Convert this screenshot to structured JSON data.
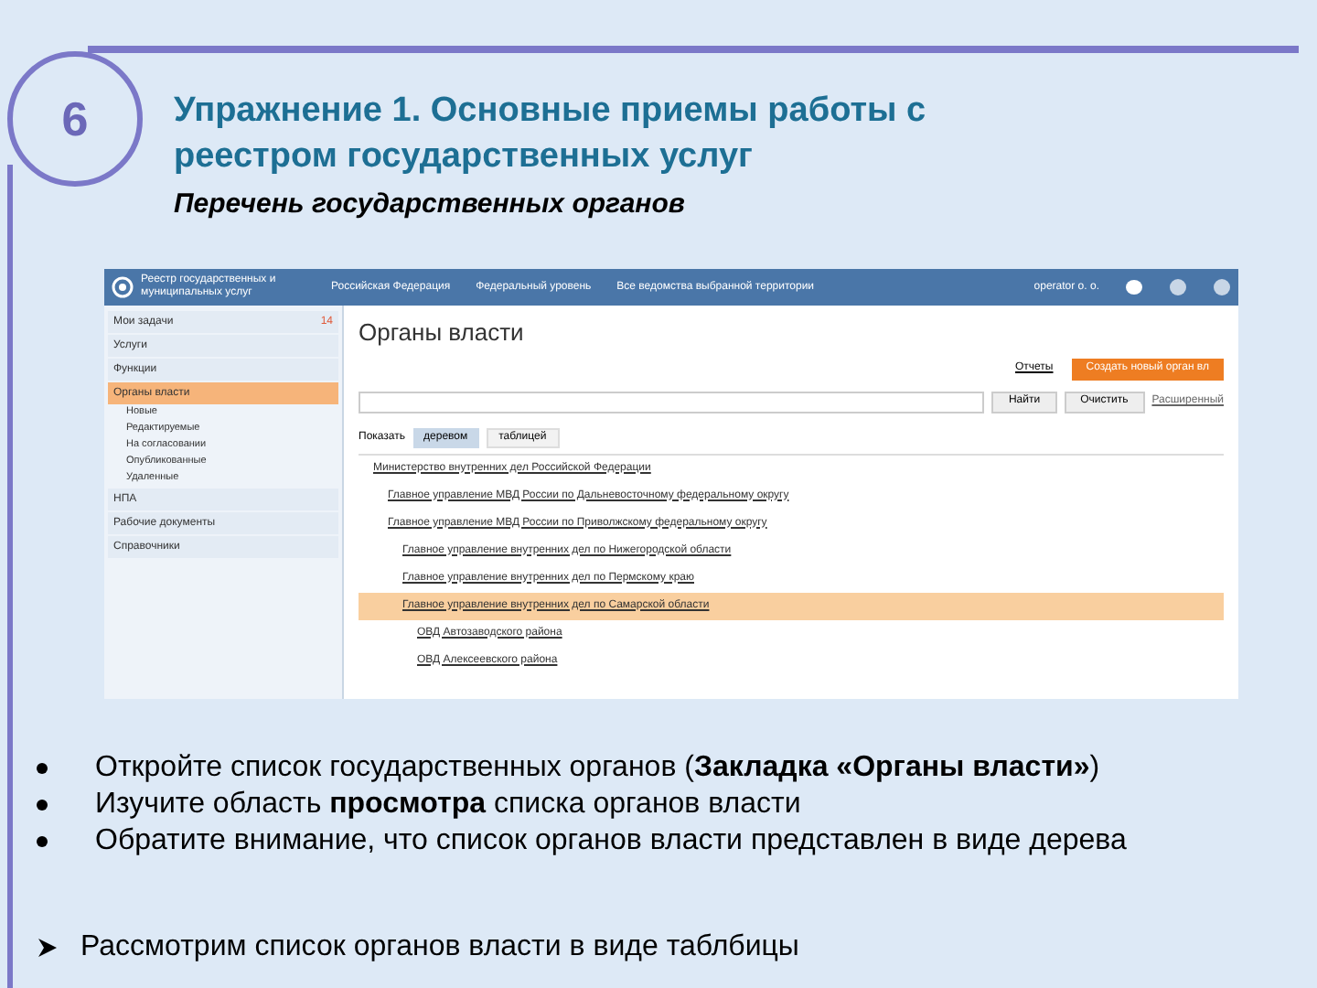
{
  "slide_number": "6",
  "title": "Упражнение 1. Основные приемы работы с реестром государственных услуг",
  "subtitle": "Перечень государственных органов",
  "app": {
    "logo_text": "Реестр государственных и муниципальных услуг",
    "nav": [
      "Российская Федерация",
      "Федеральный уровень",
      "Все ведомства выбранной территории"
    ],
    "user": "operator o. o.",
    "sidebar": [
      {
        "label": "Мои задачи",
        "badge": "14",
        "selected": false
      },
      {
        "label": "Услуги",
        "selected": false
      },
      {
        "label": "Функции",
        "selected": false
      },
      {
        "label": "Органы власти",
        "selected": true,
        "children": [
          "Новые",
          "Редактируемые",
          "На согласовании",
          "Опубликованные",
          "Удаленные"
        ]
      },
      {
        "label": "НПА",
        "selected": false
      },
      {
        "label": "Рабочие документы",
        "selected": false
      },
      {
        "label": "Справочники",
        "selected": false
      }
    ],
    "page_title": "Органы власти",
    "reports_link": "Отчеты",
    "create_button": "Создать новый орган вл",
    "find_button": "Найти",
    "clear_button": "Очистить",
    "advanced_link": "Расширенный",
    "show_label": "Показать",
    "view_tabs": [
      {
        "label": "деревом",
        "selected": true
      },
      {
        "label": "таблицей",
        "selected": false
      }
    ],
    "tree": [
      {
        "label": "Министерство внутренних дел Российской Федерации",
        "selected": false,
        "children": [
          {
            "label": "Главное управление МВД России по Дальневосточному федеральному округу",
            "selected": false
          },
          {
            "label": "Главное управление МВД России по Приволжскому федеральному округу",
            "selected": false,
            "children": [
              {
                "label": "Главное управление внутренних дел по Нижегородской области",
                "selected": false
              },
              {
                "label": "Главное управление внутренних дел по Пермскому краю",
                "selected": false
              },
              {
                "label": "Главное управление внутренних дел по Самарской области",
                "selected": true,
                "children": [
                  {
                    "label": "ОВД Автозаводского района",
                    "selected": false
                  },
                  {
                    "label": "ОВД Алексеевского района",
                    "selected": false
                  }
                ]
              }
            ]
          }
        ]
      }
    ]
  },
  "bullets": [
    "Откройте список государственных органов (**Закладка «Органы власти»**)",
    "Изучите область **просмотра** списка органов власти",
    "Обратите внимание, что список органов власти представлен в виде дерева"
  ],
  "conclusion": "Рассмотрим список органов власти в виде таблбицы"
}
